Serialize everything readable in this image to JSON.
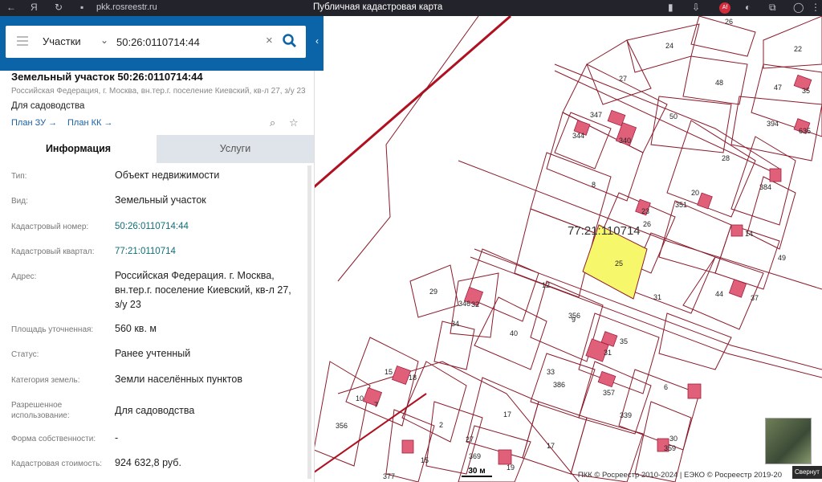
{
  "browser": {
    "url": "pkk.rosreestr.ru",
    "title": "Публичная кадастровая карта",
    "ext_badge": "Af"
  },
  "search": {
    "type": "Участки",
    "value": "50:26:0110714:44"
  },
  "object": {
    "title": "Земельный участок 50:26:0110714:44",
    "address": "Российская Федерация, г. Москва, вн.тер.г. поселение Киевский, кв-л 27, з/у 23",
    "use": "Для садоводства",
    "plan_zu": "План ЗУ →",
    "plan_kk": "План КК →"
  },
  "tabs": {
    "info": "Информация",
    "services": "Услуги"
  },
  "details": [
    {
      "label": "Тип:",
      "value": "Объект недвижимости"
    },
    {
      "label": "Вид:",
      "value": "Земельный участок"
    },
    {
      "label": "Кадастровый номер:",
      "value": "50:26:0110714:44"
    },
    {
      "label": "Кадастровый квартал:",
      "value": "77:21:0110714"
    },
    {
      "label": "Адрес:",
      "value": "Российская Федерация. г. Москва, вн.тер.г. поселение Киевский, кв-л 27, з/у 23"
    },
    {
      "label": "Площадь уточненная:",
      "value": "560 кв. м"
    },
    {
      "label": "Статус:",
      "value": "Ранее учтенный"
    },
    {
      "label": "Категория земель:",
      "value": "Земли населённых пунктов"
    },
    {
      "label": "Разрешенное использование:",
      "value": "Для садоводства"
    },
    {
      "label": "Форма собственности:",
      "value": "-"
    },
    {
      "label": "Кадастровая стоимость:",
      "value": "924 632,8 руб."
    }
  ],
  "map": {
    "quarter_label": "77:21:110714",
    "scale": "30 м",
    "attribution": "ПКК © Росреестр 2010-2024 | ЕЭКО © Росреестр 2019-20",
    "collapse": "Свернут",
    "parcels": [
      "26",
      "24",
      "22",
      "48",
      "27",
      "47",
      "35",
      "347",
      "50",
      "394",
      "635",
      "344",
      "340",
      "28",
      "8",
      "20",
      "384",
      "23",
      "351",
      "26",
      "14",
      "49",
      "25",
      "12",
      "44",
      "37",
      "29",
      "346",
      "32",
      "31",
      "356",
      "34",
      "40",
      "9",
      "31",
      "35",
      "33",
      "15",
      "18",
      "386",
      "357",
      "6",
      "10",
      "7",
      "356",
      "2",
      "17",
      "339",
      "30",
      "359",
      "27",
      "17",
      "369",
      "15",
      "19",
      "377"
    ],
    "highlight_color": "#f7f76b",
    "line_color": "#8b1a2a"
  }
}
